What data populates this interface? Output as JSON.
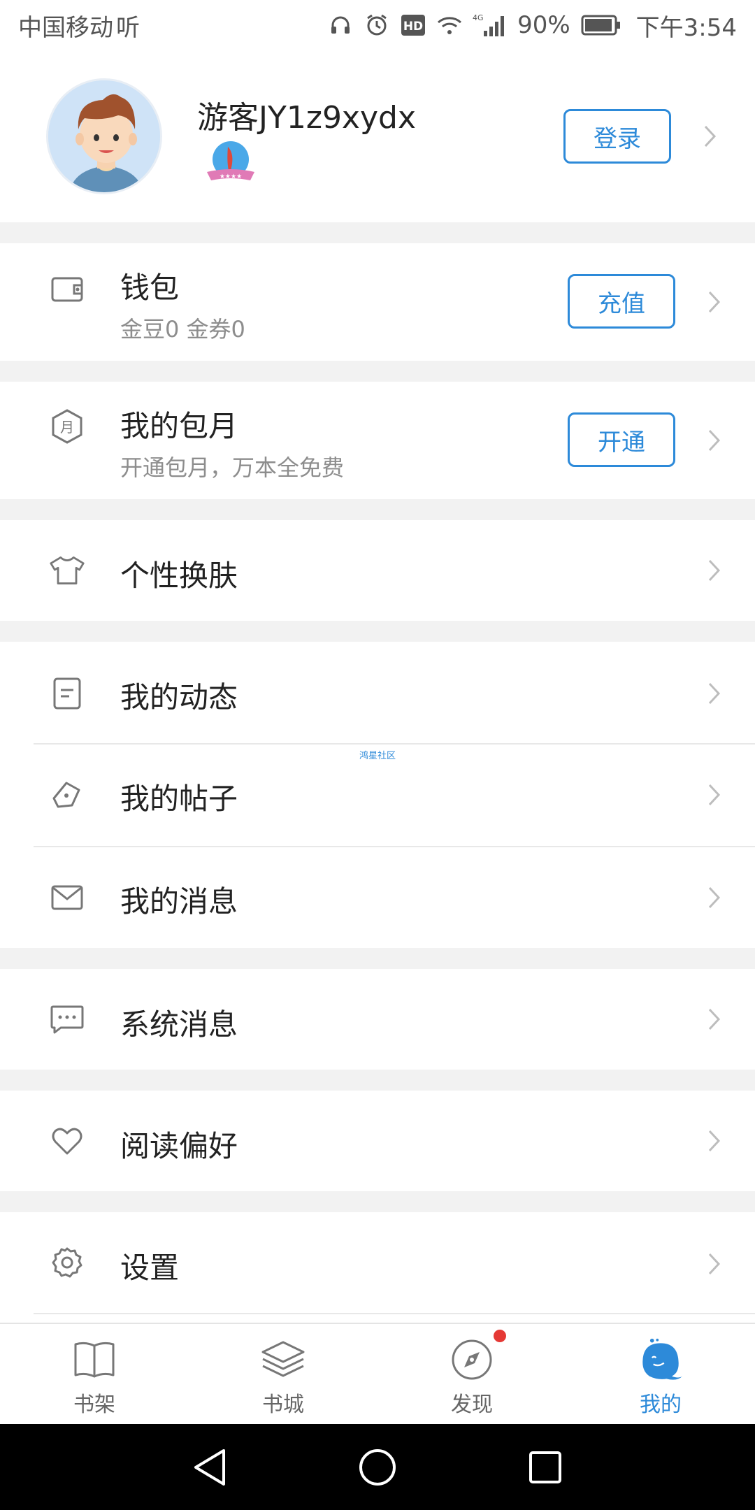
{
  "status_bar": {
    "carrier": "中国移动",
    "carrier_extra": "听",
    "battery": "90%",
    "network": "4G",
    "time": "下午3:54"
  },
  "profile": {
    "username": "游客JY1z9xydx",
    "login_label": "登录",
    "avatar_icon": "user-avatar",
    "badge_icon": "level-badge"
  },
  "wallet": {
    "title": "钱包",
    "subtitle": "金豆0 金券0",
    "action_label": "充值",
    "icon": "wallet-icon"
  },
  "monthly": {
    "title": "我的包月",
    "subtitle": "开通包月，万本全免费",
    "action_label": "开通",
    "icon": "month-icon"
  },
  "skin": {
    "title": "个性换肤",
    "icon": "shirt-icon"
  },
  "community": {
    "items": [
      {
        "title": "我的动态",
        "icon": "note-icon"
      },
      {
        "title": "我的帖子",
        "icon": "pen-icon"
      },
      {
        "title": "我的消息",
        "icon": "mail-icon"
      }
    ],
    "tiny_label": "鸿星社区"
  },
  "system_message": {
    "title": "系统消息",
    "icon": "chat-icon"
  },
  "reading_pref": {
    "title": "阅读偏好",
    "icon": "heart-icon"
  },
  "settings": {
    "title": "设置",
    "icon": "gear-icon"
  },
  "bottom_nav": {
    "items": [
      {
        "label": "书架",
        "icon": "book-icon"
      },
      {
        "label": "书城",
        "icon": "layers-icon"
      },
      {
        "label": "发现",
        "icon": "compass-icon"
      },
      {
        "label": "我的",
        "icon": "mascot-icon",
        "active": true
      }
    ]
  },
  "colors": {
    "accent": "#2d8ad9",
    "badge_red": "#e53935",
    "background": "#f2f2f2"
  }
}
